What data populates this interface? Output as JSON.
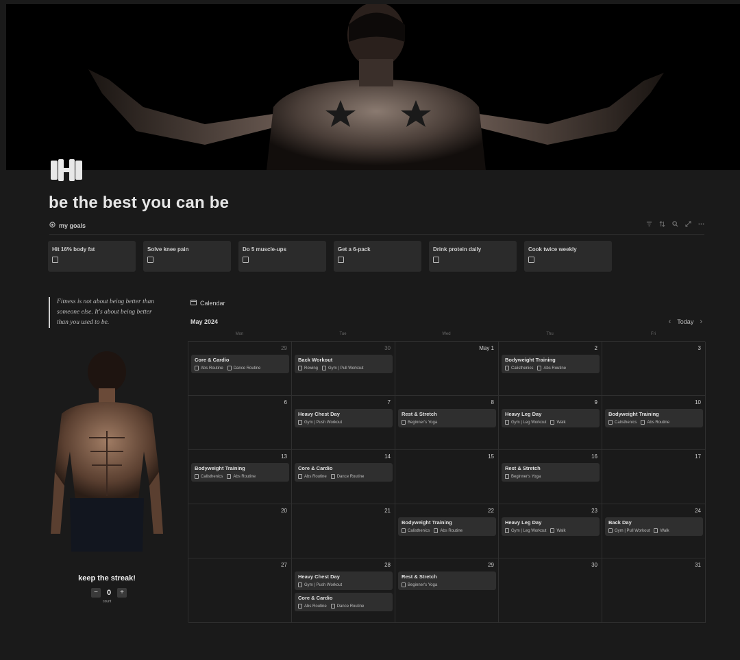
{
  "page": {
    "title": "be the best you can be",
    "icon": "dumbbell-icon"
  },
  "goals_db": {
    "title": "my goals",
    "icon": "target-icon",
    "tools": [
      "filter-icon",
      "sort-icon",
      "search-icon",
      "expand-icon",
      "more-icon"
    ],
    "items": [
      {
        "name": "Hit 16% body fat",
        "checked": false
      },
      {
        "name": "Solve knee pain",
        "checked": false
      },
      {
        "name": "Do 5 muscle-ups",
        "checked": false
      },
      {
        "name": "Get a 6-pack",
        "checked": false
      },
      {
        "name": "Drink protein daily",
        "checked": false
      },
      {
        "name": "Cook twice weekly",
        "checked": false
      }
    ]
  },
  "quote": "Fitness is not about being better than someone else. It's about being better than you used to be.",
  "streak": {
    "title": "keep the streak!",
    "minus": "−",
    "plus": "+",
    "value": "0",
    "unit": "count"
  },
  "calendar": {
    "label": "Calendar",
    "month": "May 2024",
    "today": "Today",
    "weekdays": [
      "Mon",
      "Tue",
      "Wed",
      "Thu",
      "Fri"
    ],
    "weeks": [
      [
        {
          "day": "29",
          "muted": true,
          "events": [
            {
              "title": "Core & Cardio",
              "tags": [
                "Abs Routine",
                "Dance Routine"
              ]
            }
          ]
        },
        {
          "day": "30",
          "muted": true,
          "events": [
            {
              "title": "Back Workout",
              "tags": [
                "Rowing",
                "Gym | Pull Workout"
              ]
            }
          ]
        },
        {
          "day": "May 1",
          "muted": false,
          "events": []
        },
        {
          "day": "2",
          "muted": false,
          "events": [
            {
              "title": "Bodyweight Training",
              "tags": [
                "Calisthenics",
                "Abs Routine"
              ]
            }
          ]
        },
        {
          "day": "3",
          "muted": false,
          "events": []
        }
      ],
      [
        {
          "day": "6",
          "muted": false,
          "events": []
        },
        {
          "day": "7",
          "muted": false,
          "events": [
            {
              "title": "Heavy Chest Day",
              "tags": [
                "Gym | Push Workout"
              ]
            }
          ]
        },
        {
          "day": "8",
          "muted": false,
          "events": [
            {
              "title": "Rest & Stretch",
              "tags": [
                "Beginner's Yoga"
              ]
            }
          ]
        },
        {
          "day": "9",
          "muted": false,
          "events": [
            {
              "title": "Heavy Leg Day",
              "tags": [
                "Gym | Leg Workout",
                "Walk"
              ]
            }
          ]
        },
        {
          "day": "10",
          "muted": false,
          "events": [
            {
              "title": "Bodyweight Training",
              "tags": [
                "Calisthenics",
                "Abs Routine"
              ]
            }
          ]
        }
      ],
      [
        {
          "day": "13",
          "muted": false,
          "events": [
            {
              "title": "Bodyweight Training",
              "tags": [
                "Calisthenics",
                "Abs Routine"
              ]
            }
          ]
        },
        {
          "day": "14",
          "muted": false,
          "events": [
            {
              "title": "Core & Cardio",
              "tags": [
                "Abs Routine",
                "Dance Routine"
              ]
            }
          ]
        },
        {
          "day": "15",
          "muted": false,
          "events": []
        },
        {
          "day": "16",
          "muted": false,
          "events": [
            {
              "title": "Rest & Stretch",
              "tags": [
                "Beginner's Yoga"
              ]
            }
          ]
        },
        {
          "day": "17",
          "muted": false,
          "events": []
        }
      ],
      [
        {
          "day": "20",
          "muted": false,
          "events": []
        },
        {
          "day": "21",
          "muted": false,
          "events": []
        },
        {
          "day": "22",
          "muted": false,
          "events": [
            {
              "title": "Bodyweight Training",
              "tags": [
                "Calisthenics",
                "Abs Routine"
              ]
            }
          ]
        },
        {
          "day": "23",
          "muted": false,
          "events": [
            {
              "title": "Heavy Leg Day",
              "tags": [
                "Gym | Leg Workout",
                "Walk"
              ]
            }
          ]
        },
        {
          "day": "24",
          "muted": false,
          "events": [
            {
              "title": "Back Day",
              "tags": [
                "Gym | Pull Workout",
                "Walk"
              ]
            }
          ]
        }
      ],
      [
        {
          "day": "27",
          "muted": false,
          "events": []
        },
        {
          "day": "28",
          "muted": false,
          "events": [
            {
              "title": "Heavy Chest Day",
              "tags": [
                "Gym | Push Workout"
              ]
            },
            {
              "title": "Core & Cardio",
              "tags": [
                "Abs Routine",
                "Dance Routine"
              ]
            }
          ]
        },
        {
          "day": "29",
          "muted": false,
          "events": [
            {
              "title": "Rest & Stretch",
              "tags": [
                "Beginner's Yoga"
              ]
            }
          ]
        },
        {
          "day": "30",
          "muted": false,
          "events": []
        },
        {
          "day": "31",
          "muted": false,
          "events": []
        }
      ]
    ]
  },
  "colors": {
    "background": "#1a1a1a",
    "card": "#2b2b2b",
    "event": "#2f2f2f",
    "border": "#2f2f2f",
    "text": "#d4d4d4"
  }
}
